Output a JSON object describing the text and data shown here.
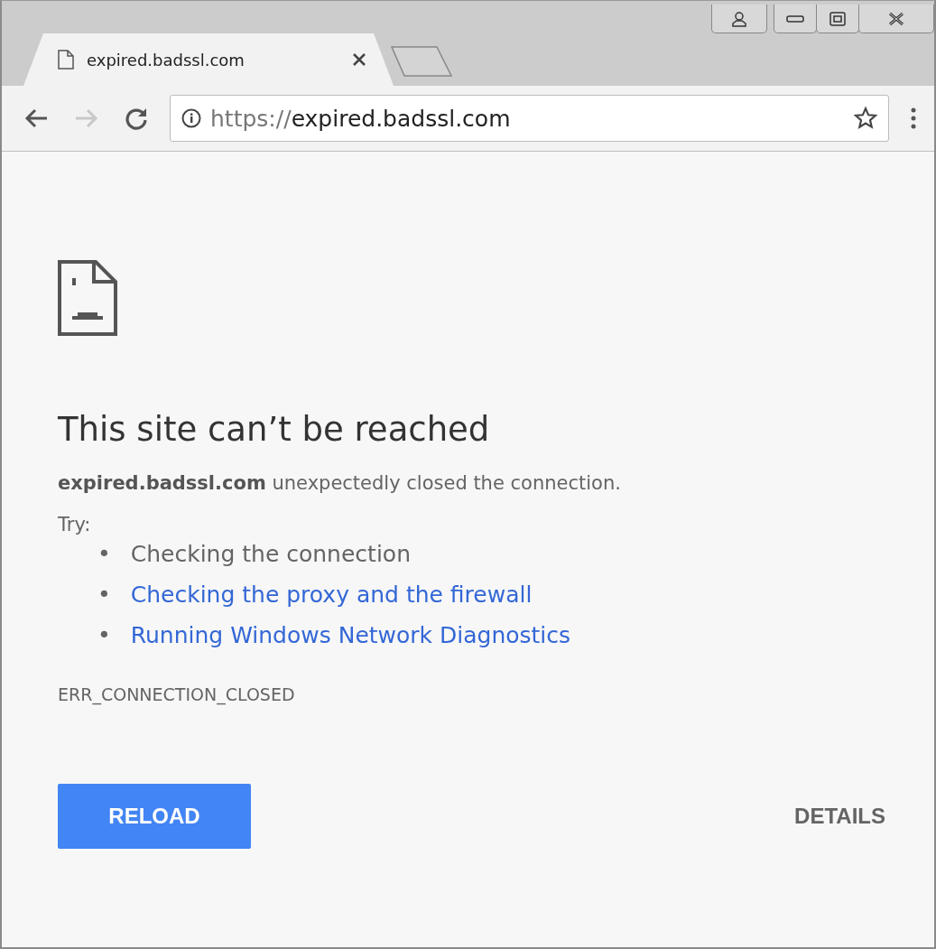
{
  "tab": {
    "title": "expired.badssl.com",
    "selected": true
  },
  "address": {
    "scheme": "https://",
    "host": "expired.badssl.com"
  },
  "nav": {
    "back_disabled": false,
    "forward_disabled": true
  },
  "error": {
    "heading": "This site can’t be reached",
    "message": "**expired.badssl.com** unexpectedly closed the connection.",
    "try_label": "Try:",
    "suggestions": [
      {
        "kind": "text",
        "bullet": "•",
        "text": "Checking the connection"
      },
      {
        "kind": "link",
        "bullet": "•",
        "text": "Checking the proxy and the firewall"
      },
      {
        "kind": "link",
        "bullet": "•",
        "text": "Running Windows Network Diagnostics"
      }
    ],
    "code": "ERR_CONNECTION_CLOSED"
  },
  "buttons": {
    "reload": "RELOAD",
    "details": "DETAILS"
  }
}
